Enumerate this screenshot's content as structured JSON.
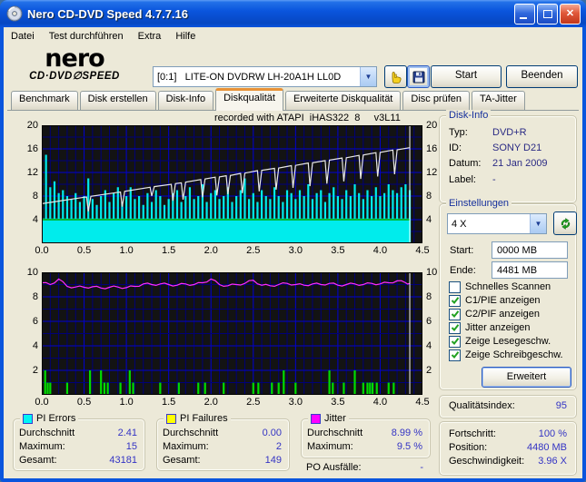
{
  "window": {
    "title": "Nero CD-DVD Speed 4.7.7.16"
  },
  "menu": {
    "items": [
      "Datei",
      "Test durchführen",
      "Extra",
      "Hilfe"
    ]
  },
  "toolbar": {
    "logo_line1": "nero",
    "logo_line2": "CD·DVD∅SPEED",
    "drive_select_value": "[0:1]   LITE-ON DVDRW LH-20A1H LL0D",
    "start_label": "Start",
    "quit_label": "Beenden"
  },
  "tabs": [
    {
      "label": "Benchmark",
      "active": false
    },
    {
      "label": "Disk erstellen",
      "active": false
    },
    {
      "label": "Disk-Info",
      "active": false
    },
    {
      "label": "Diskqualität",
      "active": true
    },
    {
      "label": "Erweiterte Diskqualität",
      "active": false
    },
    {
      "label": "Disc prüfen",
      "active": false
    },
    {
      "label": "TA-Jitter",
      "active": false
    }
  ],
  "chart_note": "recorded with ATAPI  iHAS322  8     v3L11",
  "chart_data": [
    {
      "type": "bar",
      "name": "pi-errors-and-speed",
      "x_range": [
        0,
        4.5
      ],
      "y_range": [
        0,
        20
      ],
      "x_ticks": [
        "0.0",
        "0.5",
        "1.0",
        "1.5",
        "2.0",
        "2.5",
        "3.0",
        "3.5",
        "4.0",
        "4.5"
      ],
      "y_ticks": [
        "20",
        "16",
        "12",
        "8",
        "4"
      ],
      "grid": {
        "x_minor": 0.1,
        "x_major": 0.5,
        "y_minor": 2,
        "y_major": 4
      },
      "position_marker_x": 4.35,
      "series": [
        {
          "name": "pi_errors_bars",
          "type": "bar",
          "color": "#00ECEC",
          "base_fill": 4.2,
          "x_start": 0,
          "x_step": 0.05,
          "heights": [
            11,
            15,
            9.5,
            10.5,
            8.5,
            9,
            8,
            7.5,
            8.5,
            7,
            8,
            11,
            7.5,
            6.5,
            8,
            9,
            7,
            8.5,
            9.5,
            7,
            8,
            9.5,
            7.5,
            8,
            6.5,
            8.5,
            7,
            9,
            8,
            6.5,
            7.5,
            8.5,
            9,
            7,
            8,
            9.5,
            7.5,
            8,
            10,
            7,
            8.5,
            9,
            7.5,
            8,
            9.5,
            7,
            8,
            9,
            11,
            7.5,
            8.5,
            7,
            9,
            8,
            7.5,
            9.5,
            8,
            7,
            9,
            8.5,
            7.5,
            9,
            8,
            10,
            7.5,
            8.5,
            9,
            7,
            8.5,
            9.5,
            8,
            7.5,
            9,
            8,
            10,
            8.5,
            7.5,
            9,
            8,
            9.5,
            8,
            8.5,
            10,
            9,
            8.5,
            9.5,
            10,
            9
          ]
        },
        {
          "name": "write_speed_line",
          "type": "line",
          "color": "#E8E8E8",
          "points": [
            [
              0,
              6.7
            ],
            [
              0.5,
              7.8
            ],
            [
              0.53,
              7.85
            ],
            [
              0.55,
              5.4
            ],
            [
              0.58,
              7.95
            ],
            [
              0.93,
              8.7
            ],
            [
              0.95,
              6.2
            ],
            [
              0.98,
              8.8
            ],
            [
              1.28,
              9.5
            ],
            [
              1.3,
              8.0
            ],
            [
              1.33,
              9.6
            ],
            [
              1.53,
              10.0
            ],
            [
              1.55,
              7.2
            ],
            [
              1.58,
              10.1
            ],
            [
              1.65,
              10.25
            ],
            [
              1.67,
              7.4
            ],
            [
              1.7,
              10.35
            ],
            [
              1.88,
              10.8
            ],
            [
              1.9,
              7.8
            ],
            [
              1.93,
              10.9
            ],
            [
              2.05,
              11.2
            ],
            [
              2.07,
              8.1
            ],
            [
              2.1,
              11.25
            ],
            [
              2.18,
              11.45
            ],
            [
              2.2,
              8.3
            ],
            [
              2.23,
              11.5
            ],
            [
              2.35,
              11.85
            ],
            [
              2.37,
              8.5
            ],
            [
              2.4,
              11.9
            ],
            [
              2.55,
              12.3
            ],
            [
              2.57,
              8.8
            ],
            [
              2.6,
              12.35
            ],
            [
              2.75,
              12.7
            ],
            [
              2.77,
              9.1
            ],
            [
              2.8,
              12.75
            ],
            [
              2.95,
              13.15
            ],
            [
              2.97,
              9.4
            ],
            [
              3.0,
              13.2
            ],
            [
              3.15,
              13.6
            ],
            [
              3.17,
              9.7
            ],
            [
              3.2,
              13.65
            ],
            [
              3.35,
              14.0
            ],
            [
              3.37,
              10.1
            ],
            [
              3.4,
              14.1
            ],
            [
              3.55,
              14.45
            ],
            [
              3.57,
              10.5
            ],
            [
              3.6,
              14.5
            ],
            [
              3.75,
              14.9
            ],
            [
              3.77,
              10.9
            ],
            [
              3.8,
              14.95
            ],
            [
              3.95,
              15.35
            ],
            [
              3.97,
              11.3
            ],
            [
              4.0,
              15.4
            ],
            [
              4.15,
              15.8
            ],
            [
              4.17,
              11.7
            ],
            [
              4.2,
              15.85
            ],
            [
              4.35,
              16.2
            ]
          ]
        },
        {
          "name": "read_speed_line",
          "type": "line",
          "color": "#00A800",
          "points": [
            [
              0,
              4
            ],
            [
              4.35,
              4
            ]
          ]
        }
      ]
    },
    {
      "type": "line",
      "name": "jitter-and-pi-failures",
      "x_range": [
        0,
        4.5
      ],
      "y_range": [
        0,
        10
      ],
      "x_ticks": [
        "0.0",
        "0.5",
        "1.0",
        "1.5",
        "2.0",
        "2.5",
        "3.0",
        "3.5",
        "4.0",
        "4.5"
      ],
      "y_ticks": [
        "10",
        "8",
        "6",
        "4",
        "2"
      ],
      "grid": {
        "x_minor": 0.1,
        "x_major": 0.5,
        "y_minor": 1,
        "y_major": 2
      },
      "position_marker_x": 4.35,
      "series": [
        {
          "name": "jitter_line",
          "type": "line",
          "color": "#FF2BFF",
          "x_start": 0,
          "x_step": 0.1,
          "last_x": 4.35,
          "values": [
            9.15,
            9.0,
            9.45,
            8.85,
            8.8,
            8.78,
            8.82,
            8.72,
            8.78,
            8.8,
            8.75,
            8.85,
            9.05,
            9.0,
            9.05,
            9.0,
            8.95,
            9.05,
            9.0,
            9.15,
            9.45,
            9.0,
            8.9,
            9.0,
            9.1,
            9.35,
            8.95,
            8.9,
            9.0,
            9.1,
            9.0,
            8.95,
            9.05,
            9.0,
            9.1,
            8.95,
            9.0,
            9.05,
            9.0,
            9.1,
            9.05,
            9.15,
            9.3,
            9.15,
            9.1
          ]
        },
        {
          "name": "pi_failures_bars",
          "type": "bar",
          "color": "#00DD00",
          "points": [
            [
              0.04,
              2
            ],
            [
              0.07,
              1
            ],
            [
              0.1,
              1
            ],
            [
              0.3,
              1
            ],
            [
              0.57,
              2
            ],
            [
              0.7,
              2
            ],
            [
              0.74,
              1
            ],
            [
              0.78,
              1
            ],
            [
              0.93,
              1
            ],
            [
              1.04,
              2
            ],
            [
              1.08,
              1
            ],
            [
              1.4,
              1
            ],
            [
              1.62,
              1
            ],
            [
              1.85,
              1
            ],
            [
              1.93,
              1
            ],
            [
              2.15,
              1
            ],
            [
              2.5,
              1
            ],
            [
              2.56,
              1
            ],
            [
              2.72,
              1
            ],
            [
              2.8,
              1
            ],
            [
              2.86,
              2
            ],
            [
              3.0,
              1
            ],
            [
              3.4,
              2
            ],
            [
              3.44,
              1
            ],
            [
              3.57,
              1
            ],
            [
              3.7,
              2
            ],
            [
              3.8,
              1
            ],
            [
              3.85,
              1
            ],
            [
              3.88,
              1
            ],
            [
              3.91,
              1
            ],
            [
              3.96,
              1
            ],
            [
              4.1,
              1
            ],
            [
              4.16,
              1
            ]
          ]
        }
      ]
    }
  ],
  "disk_info": {
    "title": "Disk-Info",
    "rows": [
      {
        "label": "Typ:",
        "value": "DVD+R"
      },
      {
        "label": "ID:",
        "value": "SONY D21"
      },
      {
        "label": "Datum:",
        "value": "21 Jan 2009"
      },
      {
        "label": "Label:",
        "value": "-"
      }
    ]
  },
  "settings": {
    "title": "Einstellungen",
    "speed_value": "4 X",
    "start_label": "Start:",
    "start_value": "0000 MB",
    "end_label": "Ende:",
    "end_value": "4481 MB",
    "checkboxes": [
      {
        "label": "Schnelles Scannen",
        "checked": false
      },
      {
        "label": "C1/PIE anzeigen",
        "checked": true
      },
      {
        "label": "C2/PIF anzeigen",
        "checked": true
      },
      {
        "label": "Jitter anzeigen",
        "checked": true
      },
      {
        "label": "Zeige Lesegeschw.",
        "checked": true
      },
      {
        "label": "Zeige Schreibgeschw.",
        "checked": true
      }
    ],
    "advanced_label": "Erweitert"
  },
  "quality": {
    "label": "Qualitätsindex:",
    "value": "95"
  },
  "progress": {
    "rows": [
      {
        "label": "Fortschritt:",
        "value": "100 %"
      },
      {
        "label": "Position:",
        "value": "4480 MB"
      },
      {
        "label": "Geschwindigkeit:",
        "value": "3.96 X"
      }
    ]
  },
  "stats": {
    "pi_errors": {
      "title": "PI Errors",
      "legend_color": "#00F5F5",
      "rows": [
        {
          "label": "Durchschnitt",
          "value": "2.41"
        },
        {
          "label": "Maximum:",
          "value": "15"
        },
        {
          "label": "Gesamt:",
          "value": "43181"
        }
      ]
    },
    "pi_failures": {
      "title": "PI Failures",
      "legend_color": "#FFFF00",
      "rows": [
        {
          "label": "Durchschnitt",
          "value": "0.00"
        },
        {
          "label": "Maximum:",
          "value": "2"
        },
        {
          "label": "Gesamt:",
          "value": "149"
        }
      ]
    },
    "jitter": {
      "title": "Jitter",
      "legend_color": "#FF00FF",
      "rows": [
        {
          "label": "Durchschnitt",
          "value": "8.99 %"
        },
        {
          "label": "Maximum:",
          "value": "9.5 %"
        }
      ]
    },
    "po_failures": {
      "label": "PO Ausfälle:",
      "value": "-"
    }
  }
}
